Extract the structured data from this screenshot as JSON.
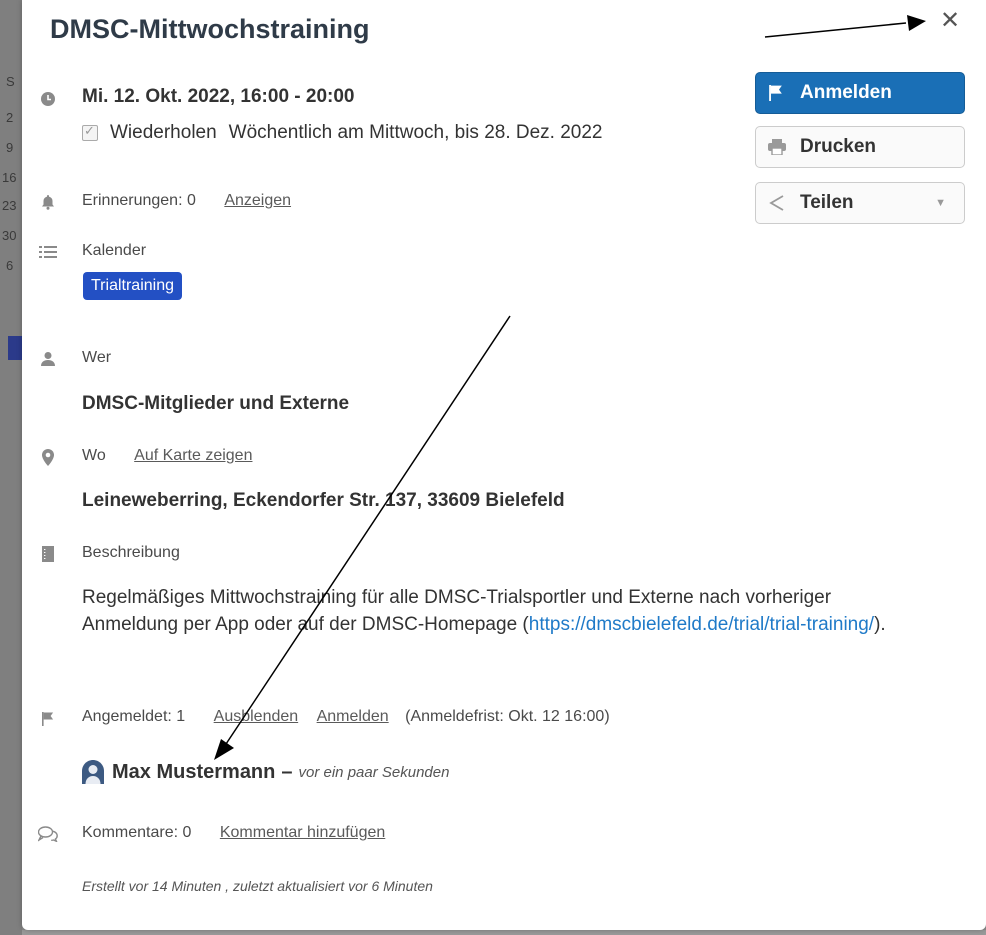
{
  "background_chars": [
    "S",
    "2",
    "9",
    "16",
    "23",
    "30",
    "6"
  ],
  "event": {
    "title": "DMSC-Mittwochstraining",
    "date_time": "Mi. 12. Okt. 2022, 16:00 - 20:00",
    "repeat_label": "Wiederholen",
    "repeat_value": "Wöchentlich am Mittwoch, bis 28. Dez. 2022",
    "reminders_label": "Erinnerungen: 0",
    "reminders_link": "Anzeigen",
    "calendar_label": "Kalender",
    "calendar_badge": "Trialtraining",
    "who_label": "Wer",
    "who_value": "DMSC-Mitglieder und Externe",
    "where_label": "Wo",
    "where_map_link": "Auf Karte zeigen",
    "where_value": "Leineweberring, Eckendorfer Str. 137, 33609 Bielefeld",
    "description_label": "Beschreibung",
    "description_text_before": "Regelmäßiges Mittwochstraining für alle DMSC-Trialsportler und Externe nach vorheriger Anmeldung per App oder auf der DMSC-Homepage (",
    "description_link": "https://dmscbielefeld.de/trial/trial-training/",
    "description_text_after": ").",
    "registered_label": "Angemeldet: 1",
    "hide_link": "Ausblenden",
    "register_link": "Anmelden",
    "deadline": "(Anmeldefrist: Okt. 12 16:00)",
    "attendee_name": "Max Mustermann",
    "attendee_separator": "–",
    "attendee_time": "vor ein paar Sekunden",
    "comments_label": "Kommentare: 0",
    "add_comment_link": "Kommentar hinzufügen",
    "footer": "Erstellt vor 14 Minuten , zuletzt aktualisiert vor 6 Minuten"
  },
  "buttons": {
    "register": "Anmelden",
    "print": "Drucken",
    "share": "Teilen"
  },
  "close_symbol": "✕",
  "colors": {
    "primary": "#1a6fb6",
    "badge": "#2350c4",
    "link": "#1f7ac8",
    "title": "#2f3b48"
  },
  "icons": [
    "clock-icon",
    "bell-icon",
    "list-icon",
    "user-icon",
    "map-pin-icon",
    "document-icon",
    "flag-icon",
    "comments-icon",
    "printer-icon",
    "share-icon",
    "avatar-icon",
    "close-icon"
  ]
}
